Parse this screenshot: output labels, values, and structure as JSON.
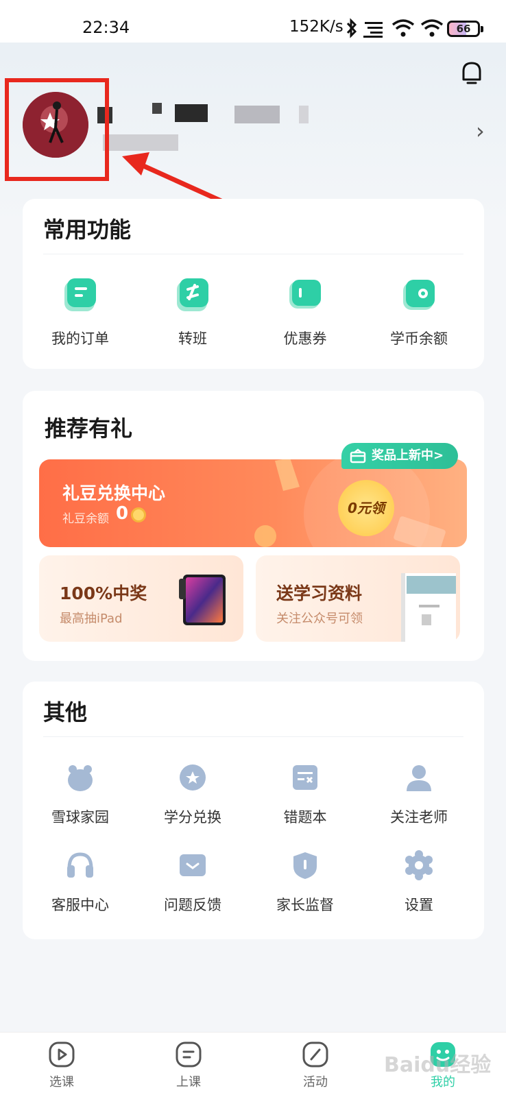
{
  "status_bar": {
    "time": "22:34",
    "network_speed": "152K/s",
    "battery": "66"
  },
  "profile": {
    "avatar": "avatar-photo",
    "chevron": "›"
  },
  "common_functions": {
    "title": "常用功能",
    "items": [
      {
        "label": "我的订单",
        "icon": "order-icon"
      },
      {
        "label": "转班",
        "icon": "transfer-class-icon"
      },
      {
        "label": "优惠券",
        "icon": "coupon-icon"
      },
      {
        "label": "学币余额",
        "icon": "wallet-icon"
      }
    ],
    "accent": "#2ecfa6"
  },
  "recommend": {
    "title": "推荐有礼",
    "exchange": {
      "title": "礼豆兑换中心",
      "balance_label": "礼豆余额",
      "balance_value": "0",
      "badge": "奖品上新中>",
      "bubble": "0元领"
    },
    "lottery": {
      "title": "100%中奖",
      "desc": "最高抽iPad"
    },
    "materials": {
      "title": "送学习资料",
      "desc": "关注公众号可领"
    }
  },
  "other": {
    "title": "其他",
    "items": [
      {
        "label": "雪球家园",
        "icon": "bear-icon"
      },
      {
        "label": "学分兑换",
        "icon": "star-coin-icon"
      },
      {
        "label": "错题本",
        "icon": "mistake-book-icon"
      },
      {
        "label": "关注老师",
        "icon": "teacher-icon"
      },
      {
        "label": "客服中心",
        "icon": "headset-icon"
      },
      {
        "label": "问题反馈",
        "icon": "feedback-icon"
      },
      {
        "label": "家长监督",
        "icon": "shield-icon"
      },
      {
        "label": "设置",
        "icon": "gear-icon"
      }
    ],
    "icon_color": "#a5b9d4"
  },
  "tabbar": {
    "tabs": [
      {
        "label": "选课",
        "icon": "play-circle-icon"
      },
      {
        "label": "上课",
        "icon": "class-icon"
      },
      {
        "label": "活动",
        "icon": "activity-icon"
      },
      {
        "label": "我的",
        "icon": "profile-icon",
        "active": true
      }
    ]
  },
  "watermark": "Baidu经验"
}
